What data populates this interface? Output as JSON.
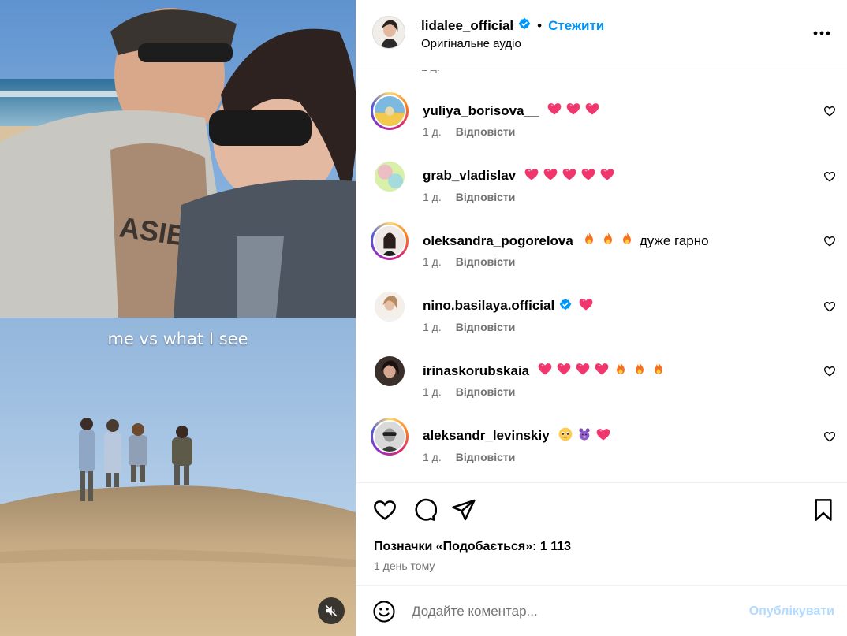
{
  "media": {
    "caption": "me vs what I see"
  },
  "header": {
    "username": "lidalee_official",
    "separator": "•",
    "follow_label": "Стежити",
    "audio": "Оригінальне аудіо"
  },
  "comments": [
    {
      "username": "yuliya_borisova__",
      "text": "",
      "emojis": [
        "heart",
        "heart",
        "heart"
      ],
      "time": "1 д.",
      "reply": "Відповісти"
    },
    {
      "username": "grab_vladislav",
      "text": "",
      "emojis": [
        "heart",
        "heart",
        "heart",
        "heart",
        "heart"
      ],
      "time": "1 д.",
      "reply": "Відповісти"
    },
    {
      "username": "oleksandra_pogorelova",
      "text": "дуже гарно",
      "emojis": [
        "fire",
        "fire",
        "fire"
      ],
      "time": "1 д.",
      "reply": "Відповісти"
    },
    {
      "username": "nino.basilaya.official",
      "text": "",
      "emojis": [
        "heart"
      ],
      "verified": true,
      "time": "1 д.",
      "reply": "Відповісти"
    },
    {
      "username": "irinaskorubskaia",
      "text": "",
      "emojis": [
        "heart",
        "heart",
        "heart",
        "heart",
        "fire",
        "fire",
        "fire"
      ],
      "time": "1 д.",
      "reply": "Відповісти"
    },
    {
      "username": "aleksandr_levinskiy",
      "text": "",
      "emojis": [
        "pleading-face",
        "purple-bear",
        "heart"
      ],
      "time": "1 д.",
      "reply": "Відповісти"
    }
  ],
  "footer": {
    "likes": "Позначки «Подобається»: 1 113",
    "date": "1 день тому",
    "comment_placeholder": "Додайте коментар...",
    "publish_label": "Опублікувати"
  },
  "colors": {
    "accent": "#0095f6",
    "publish_disabled": "#b3dbff",
    "heart_emoji": "#f0366d",
    "secondary_text": "#737373"
  }
}
